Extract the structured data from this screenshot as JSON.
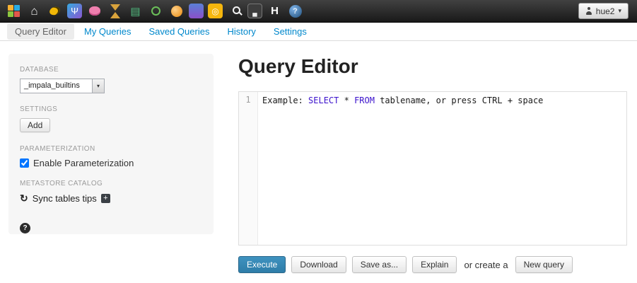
{
  "topnav": {
    "icons": [
      {
        "name": "hue-logo",
        "glyph": ""
      },
      {
        "name": "home",
        "glyph": "⌂"
      },
      {
        "name": "hive",
        "glyph": ""
      },
      {
        "name": "impala",
        "glyph": "Ψ"
      },
      {
        "name": "pig",
        "glyph": ""
      },
      {
        "name": "job-designer",
        "glyph": ""
      },
      {
        "name": "metastore",
        "glyph": "▤"
      },
      {
        "name": "spark",
        "glyph": ""
      },
      {
        "name": "oozie",
        "glyph": ""
      },
      {
        "name": "hbase",
        "glyph": ""
      },
      {
        "name": "zookeeper",
        "glyph": "◎"
      },
      {
        "name": "search",
        "glyph": ""
      },
      {
        "name": "sqoop",
        "glyph": "▄"
      },
      {
        "name": "hdfs",
        "glyph": "H"
      },
      {
        "name": "about",
        "glyph": "?"
      }
    ],
    "user_label": "hue2",
    "user_caret": "▾"
  },
  "tabs": [
    {
      "label": "Query Editor",
      "active": true
    },
    {
      "label": "My Queries",
      "active": false
    },
    {
      "label": "Saved Queries",
      "active": false
    },
    {
      "label": "History",
      "active": false
    },
    {
      "label": "Settings",
      "active": false
    }
  ],
  "sidebar": {
    "database_label": "DATABASE",
    "database_value": "_impala_builtins",
    "database_caret": "▾",
    "settings_label": "SETTINGS",
    "add_button_label": "Add",
    "parameterization_label": "PARAMETERIZATION",
    "parameterization_checkbox_label": "Enable Parameterization",
    "parameterization_checked": true,
    "metastore_label": "METASTORE CATALOG",
    "sync_icon": "↻",
    "sync_tables_label": "Sync tables tips",
    "plus_icon": "+",
    "help_icon": "?"
  },
  "main": {
    "title": "Query Editor",
    "editor": {
      "line_number": "1",
      "code_prefix": "Example: ",
      "code_keyword1": "SELECT",
      "code_middle": " * ",
      "code_keyword2": "FROM",
      "code_suffix": " tablename, or press CTRL + space",
      "keyword_color": "#3b12cc"
    },
    "actions": {
      "execute_label": "Execute",
      "download_label": "Download",
      "save_as_label": "Save as...",
      "explain_label": "Explain",
      "or_create_label": "or create a",
      "new_query_label": "New query"
    }
  },
  "colors": {
    "navbar_bg": "#2a2a2a",
    "link_blue": "#0088cc",
    "primary_button": "#338bb8",
    "sidebar_bg": "#f6f6f6"
  }
}
